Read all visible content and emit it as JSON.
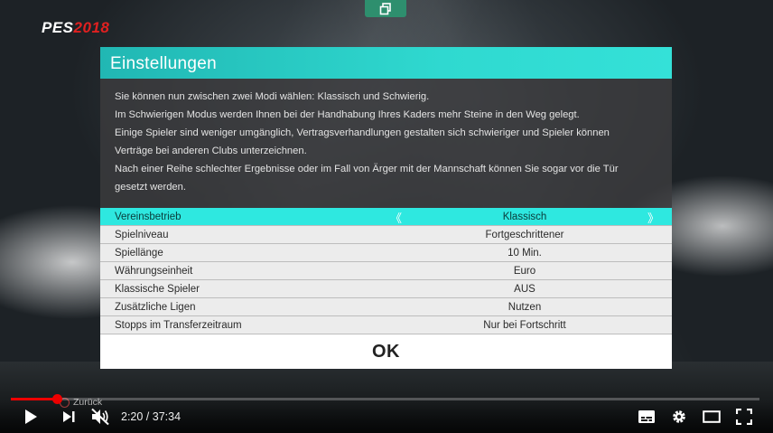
{
  "logo": {
    "part1": "PES",
    "part2": "2018"
  },
  "dialog": {
    "title": "Einstellungen",
    "description": [
      "Sie können nun zwischen zwei Modi wählen: Klassisch und Schwierig.",
      "Im Schwierigen Modus werden Ihnen bei der Handhabung Ihres Kaders mehr Steine in den Weg gelegt.",
      "Einige Spieler sind weniger umgänglich, Vertragsverhandlungen gestalten sich schwieriger und Spieler können",
      "Verträge bei anderen Clubs unterzeichnen.",
      "Nach einer Reihe schlechter Ergebnisse oder im Fall von Ärger mit der Mannschaft können Sie sogar vor die Tür",
      "gesetzt werden."
    ],
    "rows": [
      {
        "label": "Vereinsbetrieb",
        "value": "Klassisch"
      },
      {
        "label": "Spielniveau",
        "value": "Fortgeschrittener"
      },
      {
        "label": "Spiellänge",
        "value": "10 Min."
      },
      {
        "label": "Währungseinheit",
        "value": "Euro"
      },
      {
        "label": "Klassische Spieler",
        "value": "AUS"
      },
      {
        "label": "Zusätzliche Ligen",
        "value": "Nutzen"
      },
      {
        "label": "Stopps im Transferzeitraum",
        "value": "Nur bei Fortschritt"
      }
    ],
    "arrow_left": "《",
    "arrow_right": "》",
    "ok_label": "OK"
  },
  "back_hint": "Zurück",
  "player": {
    "current_time": "2:20",
    "total_time": "37:34",
    "time_display": "2:20 / 37:34",
    "progress_fraction": 0.062,
    "accent_color": "#ee0000"
  },
  "colors": {
    "header_accent": "#2fd9d0",
    "selected_row": "#2ee8e0",
    "share_button": "#2e8f6e"
  }
}
